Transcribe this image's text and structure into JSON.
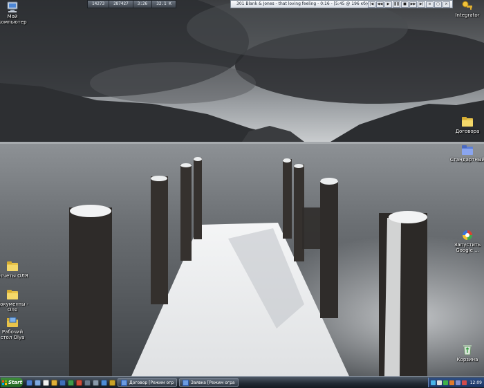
{
  "desktop": {
    "icons_left": [
      {
        "name": "my-computer",
        "label": "Мой\nкомпьютер"
      },
      {
        "name": "otchety",
        "label": "Отчеты ОЛЯ"
      },
      {
        "name": "dokumenty",
        "label": "Документы -\nОля"
      },
      {
        "name": "rabochiy-stol",
        "label": "Рабочий\nстол Olya"
      }
    ],
    "icons_right": [
      {
        "name": "integrator",
        "label": "Integrator"
      },
      {
        "name": "dogovora",
        "label": "Договора"
      },
      {
        "name": "standartny",
        "label": "Стандартный"
      },
      {
        "name": "google",
        "label": "Запустить\nGoogle ..."
      },
      {
        "name": "recycle-bin",
        "label": "Корзина"
      }
    ]
  },
  "meters": [
    "14273",
    "287427",
    "3:26",
    "32.1 K"
  ],
  "player": {
    "track": "301 Blank & Jones - that loving feeling - 0:16 - [5:45 @ 196 кб/с]",
    "controls": [
      "|◀",
      "◀◀",
      "▶",
      "❚❚",
      "■",
      "▶▶",
      "▶|",
      "≡",
      "▢",
      "×"
    ]
  },
  "taskbar": {
    "start_label": "Start",
    "tasks": [
      {
        "label": "Договор [Режим огр..."
      },
      {
        "label": "Заявка [Режим огран..."
      }
    ],
    "clock": "12:09"
  },
  "colors": {
    "taskbar": "#222a33",
    "folder": "#e8c34a"
  }
}
